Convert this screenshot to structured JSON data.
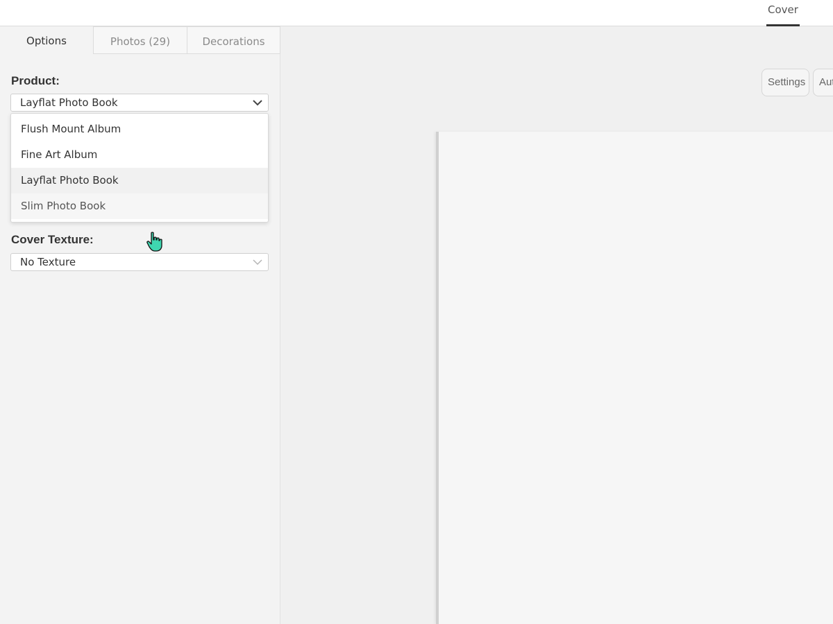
{
  "topbar": {
    "cover_tab": "Cover"
  },
  "tabs": [
    {
      "label": "Options"
    },
    {
      "label": "Photos (29)"
    },
    {
      "label": "Decorations"
    }
  ],
  "product": {
    "label": "Product:",
    "selected": "Layflat Photo Book",
    "options": [
      "Flush Mount Album",
      "Fine Art Album",
      "Layflat Photo Book",
      "Slim Photo Book"
    ]
  },
  "cover_texture": {
    "label": "Cover Texture:",
    "selected": "No Texture"
  },
  "canvas": {
    "settings_button": "Settings",
    "auto_button": "Aut"
  },
  "icons": {
    "chevron": "chevron-down-icon",
    "cursor": "hand-pointer-icon"
  },
  "colors": {
    "cursor_fill": "#3fd6b0",
    "text": "#333333",
    "muted": "#8a8a8a"
  }
}
